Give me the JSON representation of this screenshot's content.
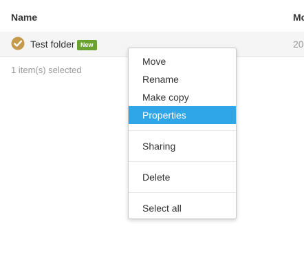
{
  "table": {
    "headers": {
      "name": "Name",
      "modified": "Mo"
    },
    "rows": [
      {
        "name": "Test folder",
        "badge": "New",
        "modified": "20",
        "selected": true
      }
    ]
  },
  "status": {
    "selection": "1 item(s) selected"
  },
  "context_menu": {
    "items": [
      {
        "label": "Move"
      },
      {
        "label": "Rename"
      },
      {
        "label": "Make copy"
      },
      {
        "label": "Properties",
        "highlighted": true
      },
      {
        "label": "Sharing"
      },
      {
        "label": "Delete"
      },
      {
        "label": "Select all"
      }
    ]
  },
  "colors": {
    "highlight": "#2fa6e8",
    "badge": "#6aa232",
    "check": "#c59a4a"
  },
  "icons": {
    "selected_check": "check-circle-icon"
  }
}
